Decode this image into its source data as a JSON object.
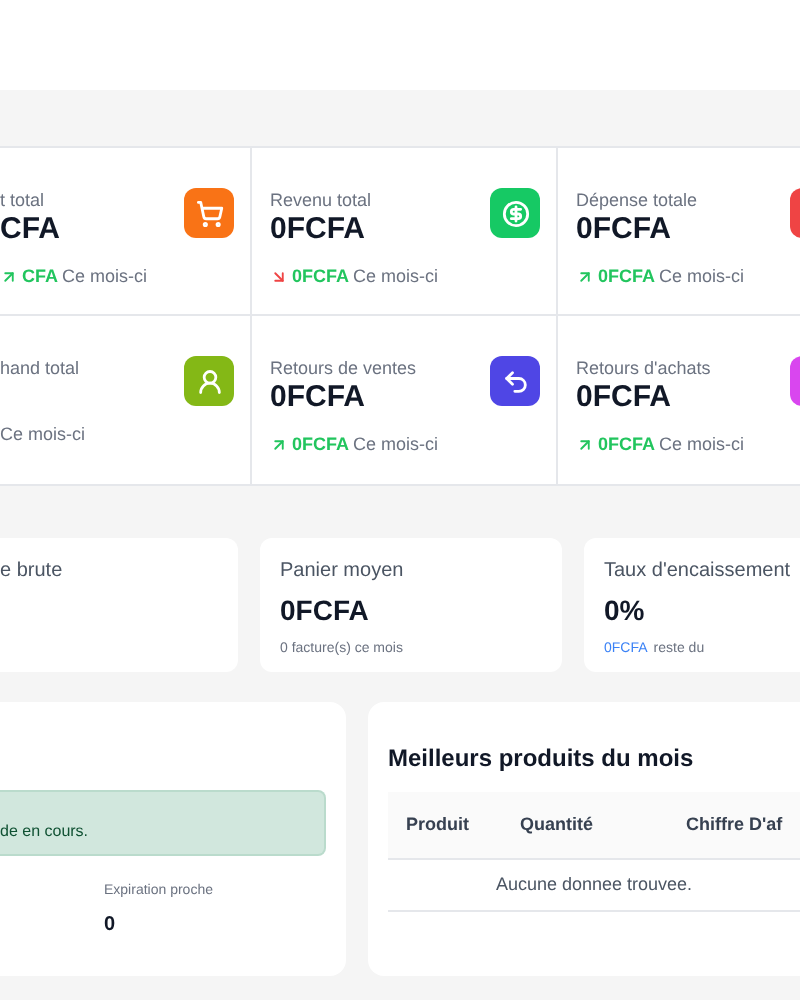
{
  "stats": [
    {
      "label": "t total",
      "value": "CFA",
      "rising": true,
      "amount": "CFA",
      "period": "Ce mois-ci",
      "kind": "cart",
      "color": "#f97316"
    },
    {
      "label": "Revenu total",
      "value": "0FCFA",
      "rising": false,
      "amount": "0FCFA",
      "period": "Ce mois-ci",
      "kind": "money",
      "color": "#16c964"
    },
    {
      "label": "Dépense totale",
      "value": "0FCFA",
      "rising": true,
      "amount": "0FCFA",
      "period": "Ce mois-ci",
      "kind": "blank",
      "color": "#ef4444"
    },
    {
      "label": "hand total",
      "period": "Ce mois-ci",
      "kind": "person",
      "color": "#84b816"
    },
    {
      "label": "Retours de ventes",
      "value": "0FCFA",
      "rising": true,
      "amount": "0FCFA",
      "period": "Ce mois-ci",
      "kind": "return",
      "color": "#4f46e5"
    },
    {
      "label": "Retours d'achats",
      "value": "0FCFA",
      "rising": true,
      "amount": "0FCFA",
      "period": "Ce mois-ci",
      "kind": "blank",
      "color": "#d946ef"
    }
  ],
  "summary": [
    {
      "label": "e brute"
    },
    {
      "label": "Panier moyen",
      "value": "0FCFA",
      "note": "0 facture(s) ce mois"
    },
    {
      "label": "Taux d'encaissement",
      "value": "0%",
      "note_amount": "0FCFA",
      "note": "reste du"
    }
  ],
  "stock": {
    "alert": "de en cours.",
    "metric_label": "Expiration proche",
    "metric_value": "0"
  },
  "best_products": {
    "title": "Meilleurs produits du mois",
    "columns": [
      "Produit",
      "Quantité",
      "Chiffre D'af"
    ],
    "empty": "Aucune donnee trouvee."
  }
}
